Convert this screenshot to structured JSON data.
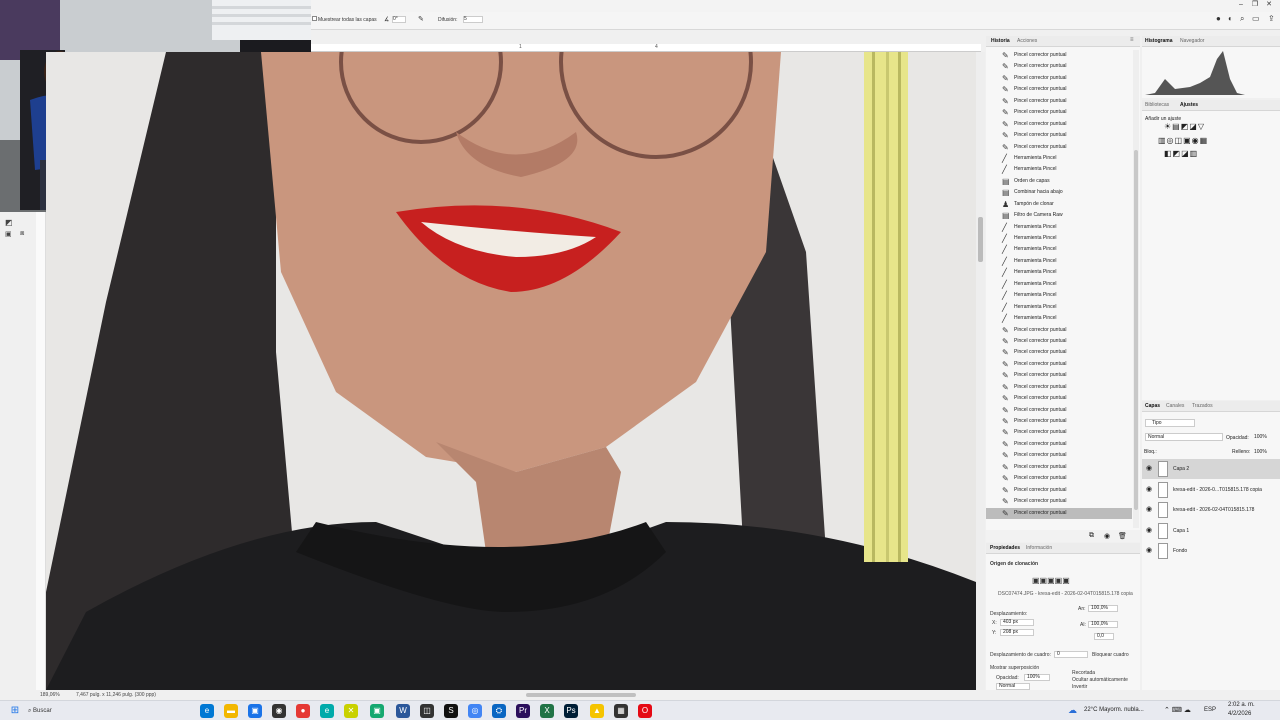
{
  "options_bar": {
    "sample_all_layers": "Muestrear todas las capas",
    "angle_value": "0°",
    "diffusion_label": "Difusión:",
    "diffusion_value": "5"
  },
  "ruler": {
    "marks": [
      "1",
      "4"
    ]
  },
  "status": {
    "zoom": "189,06%",
    "doc_size": "7,467 pulg. x 11,246 pulg. (300 ppp)"
  },
  "history_panel": {
    "tabs": [
      "Historia",
      "Acciones"
    ],
    "items": [
      {
        "label": "Pincel corrector puntual",
        "icon": "healing-brush-icon"
      },
      {
        "label": "Pincel corrector puntual",
        "icon": "healing-brush-icon"
      },
      {
        "label": "Pincel corrector puntual",
        "icon": "healing-brush-icon"
      },
      {
        "label": "Pincel corrector puntual",
        "icon": "healing-brush-icon"
      },
      {
        "label": "Pincel corrector puntual",
        "icon": "healing-brush-icon"
      },
      {
        "label": "Pincel corrector puntual",
        "icon": "healing-brush-icon"
      },
      {
        "label": "Pincel corrector puntual",
        "icon": "healing-brush-icon"
      },
      {
        "label": "Pincel corrector puntual",
        "icon": "healing-brush-icon"
      },
      {
        "label": "Pincel corrector puntual",
        "icon": "healing-brush-icon"
      },
      {
        "label": "Herramienta Pincel",
        "icon": "brush-icon"
      },
      {
        "label": "Herramienta Pincel",
        "icon": "brush-icon"
      },
      {
        "label": "Orden de capas",
        "icon": "document-icon"
      },
      {
        "label": "Combinar hacia abajo",
        "icon": "document-icon"
      },
      {
        "label": "Tampón de clonar",
        "icon": "clone-stamp-icon"
      },
      {
        "label": "Filtro de Camera Raw",
        "icon": "document-icon"
      },
      {
        "label": "Herramienta Pincel",
        "icon": "brush-icon"
      },
      {
        "label": "Herramienta Pincel",
        "icon": "brush-icon"
      },
      {
        "label": "Herramienta Pincel",
        "icon": "brush-icon"
      },
      {
        "label": "Herramienta Pincel",
        "icon": "brush-icon"
      },
      {
        "label": "Herramienta Pincel",
        "icon": "brush-icon"
      },
      {
        "label": "Herramienta Pincel",
        "icon": "brush-icon"
      },
      {
        "label": "Herramienta Pincel",
        "icon": "brush-icon"
      },
      {
        "label": "Herramienta Pincel",
        "icon": "brush-icon"
      },
      {
        "label": "Herramienta Pincel",
        "icon": "brush-icon"
      },
      {
        "label": "Pincel corrector puntual",
        "icon": "healing-brush-icon"
      },
      {
        "label": "Pincel corrector puntual",
        "icon": "healing-brush-icon"
      },
      {
        "label": "Pincel corrector puntual",
        "icon": "healing-brush-icon"
      },
      {
        "label": "Pincel corrector puntual",
        "icon": "healing-brush-icon"
      },
      {
        "label": "Pincel corrector puntual",
        "icon": "healing-brush-icon"
      },
      {
        "label": "Pincel corrector puntual",
        "icon": "healing-brush-icon"
      },
      {
        "label": "Pincel corrector puntual",
        "icon": "healing-brush-icon"
      },
      {
        "label": "Pincel corrector puntual",
        "icon": "healing-brush-icon"
      },
      {
        "label": "Pincel corrector puntual",
        "icon": "healing-brush-icon"
      },
      {
        "label": "Pincel corrector puntual",
        "icon": "healing-brush-icon"
      },
      {
        "label": "Pincel corrector puntual",
        "icon": "healing-brush-icon"
      },
      {
        "label": "Pincel corrector puntual",
        "icon": "healing-brush-icon"
      },
      {
        "label": "Pincel corrector puntual",
        "icon": "healing-brush-icon"
      },
      {
        "label": "Pincel corrector puntual",
        "icon": "healing-brush-icon"
      },
      {
        "label": "Pincel corrector puntual",
        "icon": "healing-brush-icon"
      },
      {
        "label": "Pincel corrector puntual",
        "icon": "healing-brush-icon"
      },
      {
        "label": "Pincel corrector puntual",
        "icon": "healing-brush-icon"
      }
    ]
  },
  "properties_panel": {
    "tabs": [
      "Propiedades",
      "Información"
    ],
    "section": "Origen de clonación",
    "source_file": "DSC07474.JPG - kresa-edit - 2026-02-04T015815.178 copia",
    "offset_label": "Desplazamiento:",
    "x_label": "X:",
    "x_value": "403 px",
    "y_label": "Y:",
    "y_value": "208 px",
    "width_label": "An:",
    "width_value": "100,0%",
    "height_label": "Al:",
    "height_value": "100,0%",
    "angle_value": "0,0",
    "frame_offset_label": "Desplazamiento de cuadro:",
    "frame_offset_value": "0",
    "lock_frame": "Bloquear cuadro",
    "show_overlay": "Mostrar superposición",
    "opacity_label": "Opacidad:",
    "opacity_value": "100%",
    "clipped": "Recortada",
    "auto_hide": "Ocultar automáticamente",
    "invert": "Invertir",
    "blend_mode": "Normal"
  },
  "histogram_panel": {
    "tabs": [
      "Histograma",
      "Navegador"
    ]
  },
  "adjust_panel": {
    "tabs": [
      "Bibliotecas",
      "Ajustes"
    ],
    "add_label": "Añadir un ajuste"
  },
  "layers_panel": {
    "tabs": [
      "Capas",
      "Canales",
      "Trazados"
    ],
    "filter": "Tipo",
    "blend_mode": "Normal",
    "opacity_label": "Opacidad:",
    "opacity_value": "100%",
    "lock_label": "Bloq.:",
    "fill_label": "Relleno:",
    "fill_value": "100%",
    "layers": [
      {
        "name": "Capa 2",
        "selected": true
      },
      {
        "name": "kresa-edit - 2026-0...T015815.178 copia",
        "selected": false
      },
      {
        "name": "kresa-edit - 2026-02-04T015815.178",
        "selected": false
      },
      {
        "name": "Capa 1",
        "selected": false
      },
      {
        "name": "Fondo",
        "selected": false
      }
    ]
  },
  "taskbar": {
    "search_placeholder": "Buscar",
    "weather": "22°C  Mayorm. nubla...",
    "lang": "ESP",
    "time": "2:02 a. m.",
    "date": "4/2/2026"
  }
}
